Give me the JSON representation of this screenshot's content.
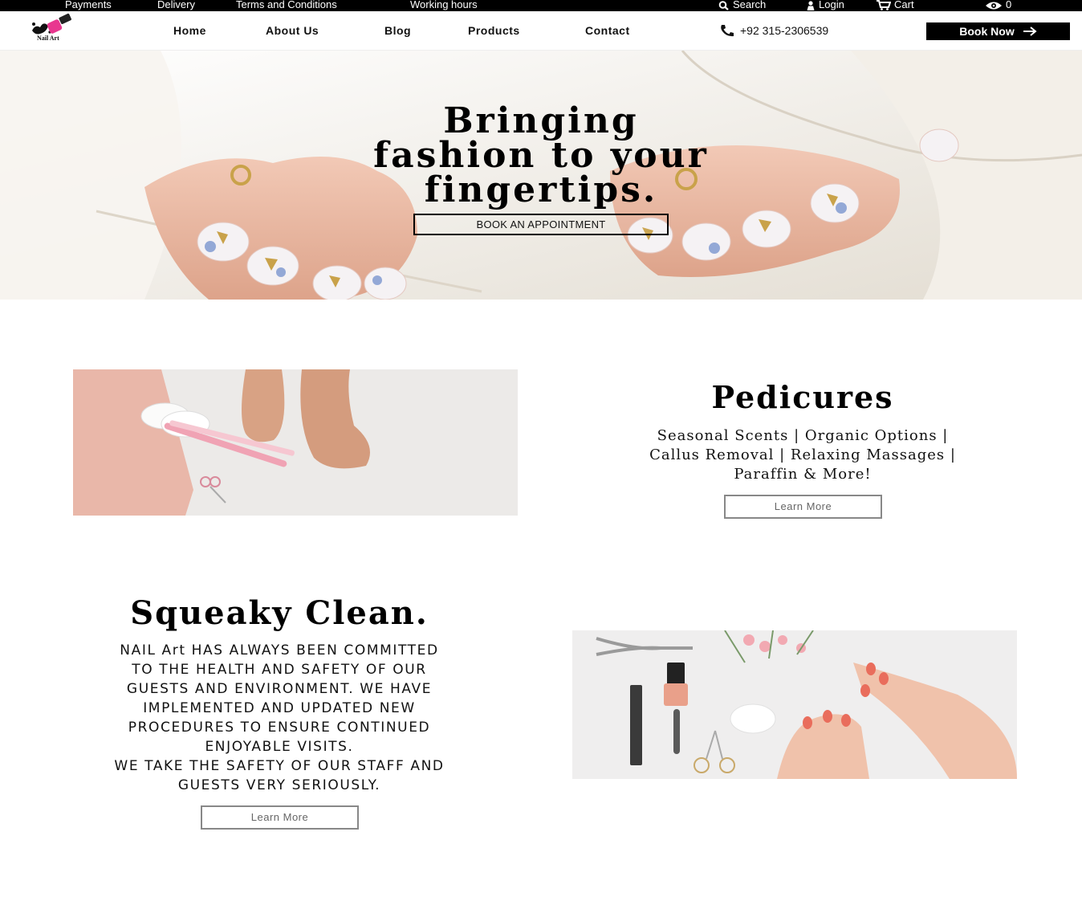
{
  "topbar": {
    "links": [
      "Payments",
      "Delivery",
      "Terms and Conditions",
      "Working hours"
    ],
    "search_label": "Search",
    "login_label": "Login",
    "cart_label": "Cart",
    "view_count": "0"
  },
  "header": {
    "logo_text": "Nail Art",
    "nav": [
      "Home",
      "About Us",
      "Blog",
      "Products",
      "Contact"
    ],
    "phone": "+92 315-2306539",
    "book_now_label": "Book Now"
  },
  "hero": {
    "title_line1": "Bringing",
    "title_line2": "fashion to your",
    "title_line3": "fingertips.",
    "button_label": "BOOK AN APPOINTMENT"
  },
  "pedicures": {
    "title": "Pedicures",
    "line1": "Seasonal Scents | Organic Options |",
    "line2": "Callus Removal | Relaxing Massages |",
    "line3": "Paraffin & More!",
    "button_label": "Learn More"
  },
  "clean": {
    "title": "Squeaky Clean.",
    "line1": "NAIL Art HAS ALWAYS BEEN COMMITTED",
    "line2": "TO THE HEALTH AND SAFETY OF OUR",
    "line3": "GUESTS AND ENVIRONMENT. WE HAVE",
    "line4": "IMPLEMENTED AND UPDATED NEW",
    "line5": "PROCEDURES TO ENSURE CONTINUED",
    "line6": "ENJOYABLE VISITS.",
    "line7": "WE TAKE THE SAFETY OF OUR STAFF AND",
    "line8": "GUESTS VERY SERIOUSLY.",
    "button_label": "Learn More"
  },
  "colors": {
    "accent_pink": "#e8378f",
    "black": "#000000"
  },
  "icons": [
    "search-icon",
    "user-icon",
    "cart-icon",
    "eye-icon",
    "phone-icon",
    "arrow-right-icon"
  ]
}
